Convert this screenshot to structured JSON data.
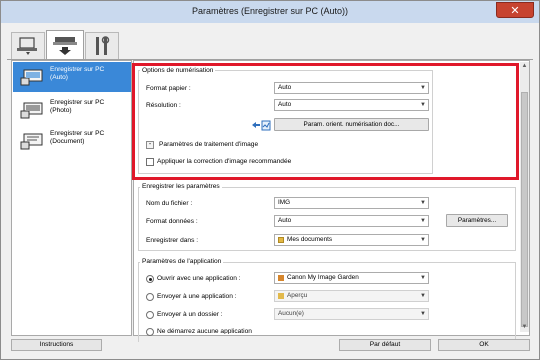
{
  "window": {
    "title": "Paramètres (Enregistrer sur PC (Auto))",
    "close_glyph": "✕"
  },
  "tabs": [
    {
      "icon": "scan-from-computer-icon"
    },
    {
      "icon": "scan-from-panel-icon",
      "active": true
    },
    {
      "icon": "general-settings-icon"
    }
  ],
  "sidebar": {
    "items": [
      {
        "label": "Enregistrer sur PC (Auto)",
        "icon": "scanner-auto-icon",
        "active": true
      },
      {
        "label": "Enregistrer sur PC (Photo)",
        "icon": "scanner-photo-icon"
      },
      {
        "label": "Enregistrer sur PC (Document)",
        "icon": "scanner-document-icon"
      }
    ]
  },
  "scan_options": {
    "title": "Options de numérisation",
    "paper_size_label": "Format papier :",
    "paper_size_value": "Auto",
    "resolution_label": "Résolution :",
    "resolution_value": "Auto",
    "orientation_button": "Param. orient. numérisation doc...",
    "image_processing_label": "Paramètres de traitement d'image",
    "correction_label": "Appliquer la correction d'image recommandée"
  },
  "save_settings": {
    "title": "Enregistrer les paramètres",
    "filename_label": "Nom du fichier :",
    "filename_value": "IMG",
    "format_label": "Format données :",
    "format_value": "Auto",
    "format_button": "Paramètres...",
    "save_in_label": "Enregistrer dans :",
    "save_in_value": "Mes documents"
  },
  "app_settings": {
    "title": "Paramètres de l'application",
    "open_app_label": "Ouvrir avec une application :",
    "open_app_value": "Canon My Image Garden",
    "send_app_label": "Envoyer à une application :",
    "send_app_value": "Aperçu",
    "send_folder_label": "Envoyer à un dossier :",
    "send_folder_value": "Aucun(e)",
    "no_app_label": "Ne démarrez aucune application"
  },
  "footer": {
    "instructions": "Instructions",
    "defaults": "Par défaut",
    "ok": "OK"
  },
  "colors": {
    "accent": "#3a88d8",
    "highlight_frame": "#e0182a",
    "close": "#c7432f"
  }
}
